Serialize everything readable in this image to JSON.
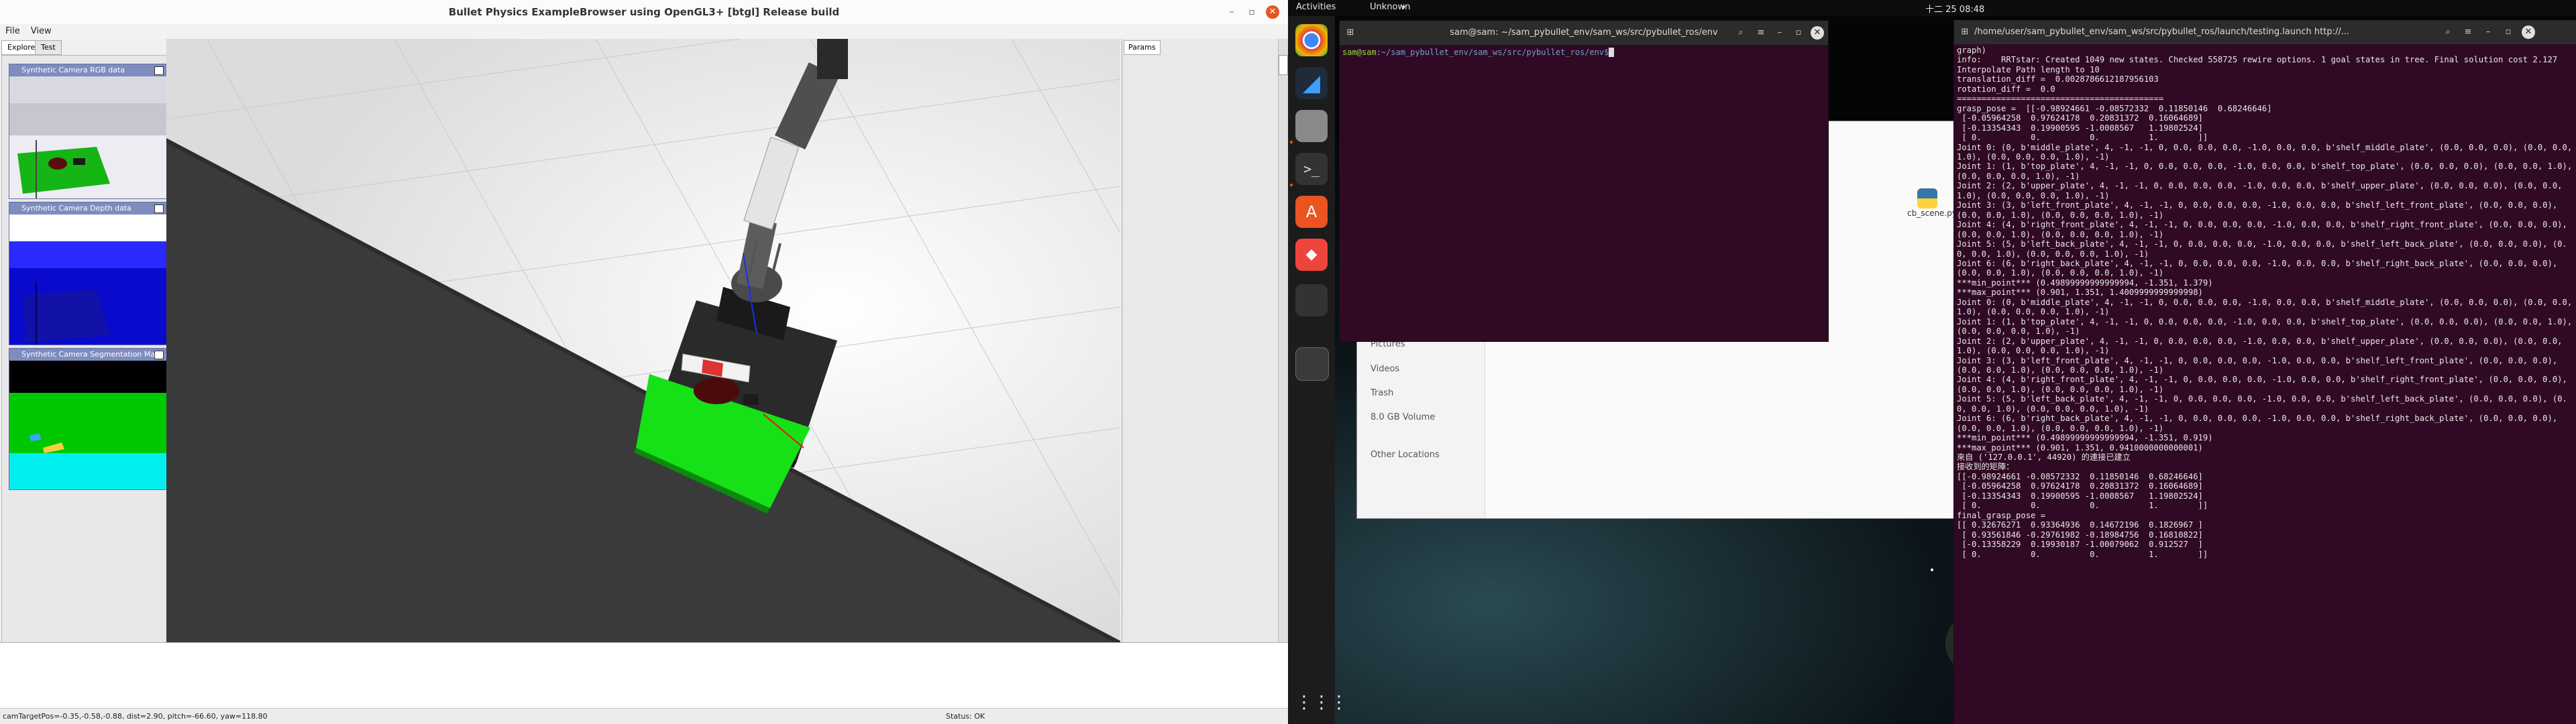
{
  "bullet": {
    "title": "Bullet Physics ExampleBrowser using OpenGL3+ [btgl] Release build",
    "menu": [
      "File",
      "View"
    ],
    "tabs": [
      "Explorer",
      "Test"
    ],
    "viewports": [
      {
        "title": "Synthetic Camera RGB data"
      },
      {
        "title": "Synthetic Camera Depth data"
      },
      {
        "title": "Synthetic Camera Segmentation Mask"
      }
    ],
    "params_tab": "Params",
    "status_left": "camTargetPos=-0.35,-0.58,-0.88, dist=2.90, pitch=-66.60, yaw=118.80",
    "status_right": "Status: OK"
  },
  "topbar": {
    "activities": "Activities",
    "app": "Unknown",
    "clock": "十二 25  08:48"
  },
  "dock": {
    "icons": [
      "chrome-icon",
      "vscode-icon",
      "files-icon",
      "terminal-icon",
      "software-store-icon",
      "anydesk-icon",
      "usb-drive-icon",
      "app-grid-icon"
    ]
  },
  "files": {
    "sidebar": [
      "Pictures",
      "Videos",
      "Trash",
      "8.0 GB Volume",
      "Other Locations"
    ],
    "file_name": "cb_scene.py"
  },
  "term1": {
    "title": "sam@sam: ~/sam_pybullet_env/sam_ws/src/pybullet_ros/env",
    "prompt_user": "sam@sam",
    "prompt_path": ":~/sam_pybullet_env/sam_ws/src/pybullet_ros/env$"
  },
  "term2": {
    "title": "/home/user/sam_pybullet_env/sam_ws/src/pybullet_ros/launch/testing.launch http://...",
    "output": "graph)\ninfo:    RRTstar: Created 1049 new states. Checked 558725 rewire options. 1 goal states in tree. Final solution cost 2.127\nInterpolate Path length to 10\ntranslation_diff =  0.0028786612187956103\nrotation_diff =  0.0\n==========================================\ngrasp_pose =  [[-0.98924661 -0.08572332  0.11850146  0.68246646]\n [-0.05964258  0.97624178  0.20831372  0.16064689]\n [-0.13354343  0.19900595 -1.0008567   1.19802524]\n [ 0.          0.          0.          1.        ]]\nJoint 0: (0, b'middle_plate', 4, -1, -1, 0, 0.0, 0.0, 0.0, -1.0, 0.0, 0.0, b'shelf_middle_plate', (0.0, 0.0, 0.0), (0.0, 0.0, 1.0), (0.0, 0.0, 0.0, 1.0), -1)\nJoint 1: (1, b'top_plate', 4, -1, -1, 0, 0.0, 0.0, 0.0, -1.0, 0.0, 0.0, b'shelf_top_plate', (0.0, 0.0, 0.0), (0.0, 0.0, 1.0), (0.0, 0.0, 0.0, 1.0), -1)\nJoint 2: (2, b'upper_plate', 4, -1, -1, 0, 0.0, 0.0, 0.0, -1.0, 0.0, 0.0, b'shelf_upper_plate', (0.0, 0.0, 0.0), (0.0, 0.0, 1.0), (0.0, 0.0, 0.0, 1.0), -1)\nJoint 3: (3, b'left_front_plate', 4, -1, -1, 0, 0.0, 0.0, 0.0, -1.0, 0.0, 0.0, b'shelf_left_front_plate', (0.0, 0.0, 0.0), (0.0, 0.0, 1.0), (0.0, 0.0, 0.0, 1.0), -1)\nJoint 4: (4, b'right_front_plate', 4, -1, -1, 0, 0.0, 0.0, 0.0, -1.0, 0.0, 0.0, b'shelf_right_front_plate', (0.0, 0.0, 0.0), (0.0, 0.0, 1.0), (0.0, 0.0, 0.0, 1.0), -1)\nJoint 5: (5, b'left_back_plate', 4, -1, -1, 0, 0.0, 0.0, 0.0, -1.0, 0.0, 0.0, b'shelf_left_back_plate', (0.0, 0.0, 0.0), (0.0, 0.0, 1.0), (0.0, 0.0, 0.0, 1.0), -1)\nJoint 6: (6, b'right_back_plate', 4, -1, -1, 0, 0.0, 0.0, 0.0, -1.0, 0.0, 0.0, b'shelf_right_back_plate', (0.0, 0.0, 0.0), (0.0, 0.0, 1.0), (0.0, 0.0, 0.0, 1.0), -1)\n***min_point*** (0.49899999999999994, -1.351, 1.379)\n***max_point*** (0.901, 1.351, 1.4009999999999998)\nJoint 0: (0, b'middle_plate', 4, -1, -1, 0, 0.0, 0.0, 0.0, -1.0, 0.0, 0.0, b'shelf_middle_plate', (0.0, 0.0, 0.0), (0.0, 0.0, 1.0), (0.0, 0.0, 0.0, 1.0), -1)\nJoint 1: (1, b'top_plate', 4, -1, -1, 0, 0.0, 0.0, 0.0, -1.0, 0.0, 0.0, b'shelf_top_plate', (0.0, 0.0, 0.0), (0.0, 0.0, 1.0), (0.0, 0.0, 0.0, 1.0), -1)\nJoint 2: (2, b'upper_plate', 4, -1, -1, 0, 0.0, 0.0, 0.0, -1.0, 0.0, 0.0, b'shelf_upper_plate', (0.0, 0.0, 0.0), (0.0, 0.0, 1.0), (0.0, 0.0, 0.0, 1.0), -1)\nJoint 3: (3, b'left_front_plate', 4, -1, -1, 0, 0.0, 0.0, 0.0, -1.0, 0.0, 0.0, b'shelf_left_front_plate', (0.0, 0.0, 0.0), (0.0, 0.0, 1.0), (0.0, 0.0, 0.0, 1.0), -1)\nJoint 4: (4, b'right_front_plate', 4, -1, -1, 0, 0.0, 0.0, 0.0, -1.0, 0.0, 0.0, b'shelf_right_front_plate', (0.0, 0.0, 0.0), (0.0, 0.0, 1.0), (0.0, 0.0, 0.0, 1.0), -1)\nJoint 5: (5, b'left_back_plate', 4, -1, -1, 0, 0.0, 0.0, 0.0, -1.0, 0.0, 0.0, b'shelf_left_back_plate', (0.0, 0.0, 0.0), (0.0, 0.0, 1.0), (0.0, 0.0, 0.0, 1.0), -1)\nJoint 6: (6, b'right_back_plate', 4, -1, -1, 0, 0.0, 0.0, 0.0, -1.0, 0.0, 0.0, b'shelf_right_back_plate', (0.0, 0.0, 0.0), (0.0, 0.0, 1.0), (0.0, 0.0, 0.0, 1.0), -1)\n***min_point*** (0.49899999999999994, -1.351, 0.919)\n***max_point*** (0.901, 1.351, 0.9410000000000001)\n來自 ('127.0.0.1', 44920) 的連接已建立\n接收到的矩陣：\n[[-0.98924661 -0.08572332  0.11850146  0.68246646]\n [-0.05964258  0.97624178  0.20831372  0.16064689]\n [-0.13354343  0.19900595 -1.0008567   1.19802524]\n [ 0.          0.          0.          1.        ]]\nfinal_grasp_pose =\n[[ 0.32676271  0.93364936  0.14672196  0.1826967 ]\n [ 0.93561846 -0.29761982 -0.18984756  0.16810822]\n [-0.13358229  0.19930187 -1.00079062  0.912527  ]\n [ 0.          0.          0.          1.        ]]"
  }
}
